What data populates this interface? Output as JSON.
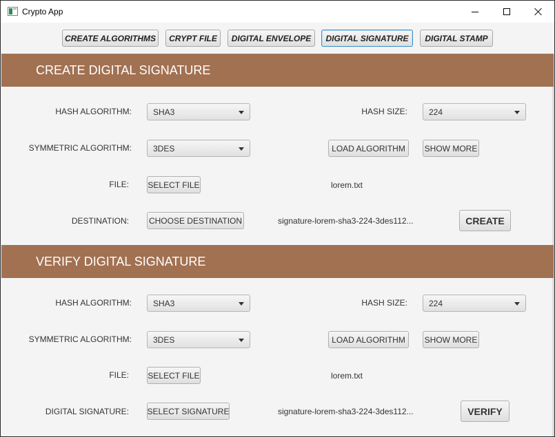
{
  "window": {
    "title": "Crypto App"
  },
  "nav": {
    "tabs": [
      {
        "label": "CREATE ALGORITHMS"
      },
      {
        "label": "CRYPT FILE"
      },
      {
        "label": "DIGITAL ENVELOPE"
      },
      {
        "label": "DIGITAL SIGNATURE"
      },
      {
        "label": "DIGITAL STAMP"
      }
    ],
    "active": "DIGITAL SIGNATURE"
  },
  "create": {
    "header": "CREATE DIGITAL SIGNATURE",
    "hash_algorithm_label": "HASH ALGORITHM:",
    "hash_algorithm_value": "SHA3",
    "hash_size_label": "HASH SIZE:",
    "hash_size_value": "224",
    "symmetric_label": "SYMMETRIC ALGORITHM:",
    "symmetric_value": "3DES",
    "load_algorithm": "LOAD ALGORITHM",
    "show_more": "SHOW MORE",
    "file_label": "FILE:",
    "select_file": "SELECT FILE",
    "file_name": "lorem.txt",
    "destination_label": "DESTINATION:",
    "choose_destination": "CHOOSE DESTINATION",
    "destination_value": "signature-lorem-sha3-224-3des112...",
    "create_button": "CREATE"
  },
  "verify": {
    "header": "VERIFY DIGITAL SIGNATURE",
    "hash_algorithm_label": "HASH ALGORITHM:",
    "hash_algorithm_value": "SHA3",
    "hash_size_label": "HASH SIZE:",
    "hash_size_value": "224",
    "symmetric_label": "SYMMETRIC ALGORITHM:",
    "symmetric_value": "3DES",
    "load_algorithm": "LOAD ALGORITHM",
    "show_more": "SHOW MORE",
    "file_label": "FILE:",
    "select_file": "SELECT FILE",
    "file_name": "lorem.txt",
    "signature_label": "DIGITAL SIGNATURE:",
    "select_signature": "SELECT SIGNATURE",
    "signature_value": "signature-lorem-sha3-224-3des112...",
    "verify_button": "VERIFY"
  },
  "colors": {
    "header_bg": "#a27152",
    "header_text": "#ffffff",
    "active_tab_border": "#3d8fc8"
  }
}
